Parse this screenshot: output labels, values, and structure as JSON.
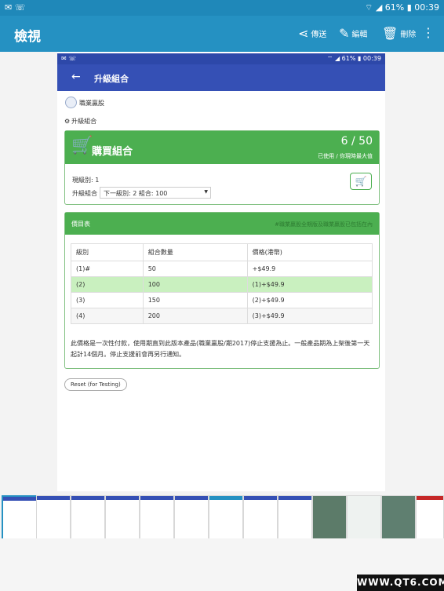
{
  "status": {
    "left": "✉ ☏",
    "right": "⌔ ◢ 61% ▮ 00:39"
  },
  "appbar": {
    "title": "檢視",
    "actions": [
      {
        "icon": "share-icon",
        "label": "傳送"
      },
      {
        "icon": "edit-icon",
        "label": "編輯"
      },
      {
        "icon": "delete-icon",
        "label": "刪除"
      }
    ]
  },
  "inner": {
    "status": {
      "left": "✉ ☏",
      "right": "⌔ ◢ 61% ▮ 00:39"
    },
    "appbar_title": "升級組合",
    "company": "職業贏股",
    "section_heading": "升級組合",
    "buy": {
      "title": "購買組合",
      "used": "6",
      "max": "50",
      "caption": "已使用 / 你現時最大值",
      "current_level_label": "現級別: 1",
      "upgrade_label": "升級組合",
      "select_value": "下一級別: 2 組合: 100"
    },
    "price": {
      "title": "價目表",
      "note": "#職業贏股全期版及職業贏股已包括在內",
      "headers": [
        "級別",
        "組合數量",
        "價格(港幣)"
      ],
      "rows": [
        [
          "(1)#",
          "50",
          "+$49.9"
        ],
        [
          "(2)",
          "100",
          "(1)+$49.9"
        ],
        [
          "(3)",
          "150",
          "(2)+$49.9"
        ],
        [
          "(4)",
          "200",
          "(3)+$49.9"
        ]
      ],
      "footnote": "此價格是一次性付款，使用期直到此版本產品(職業贏股/期2017)停止支援為止。一般產品期為上架後第一天起計14個月。停止支援前會再另行通知。"
    },
    "reset_button": "Reset (for Testing)"
  },
  "watermark": "WWW.QT6.COM",
  "colors": {
    "appbar": "#2591c2",
    "inner_appbar": "#3550b5",
    "green": "#4caf50",
    "highlight": "#c9f0bf"
  }
}
